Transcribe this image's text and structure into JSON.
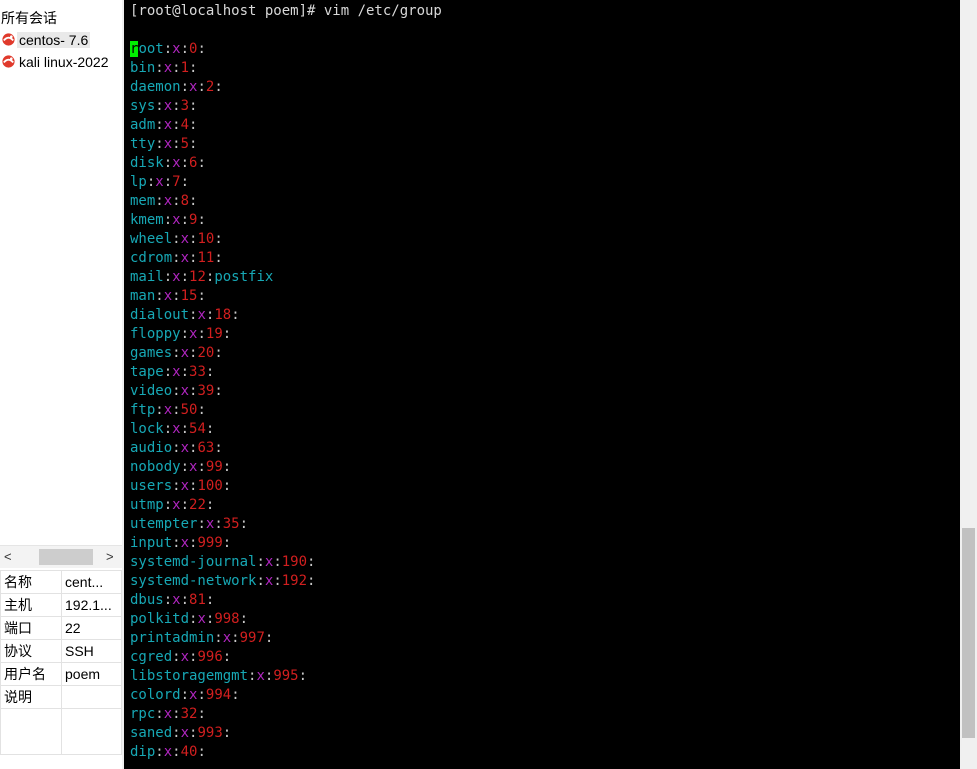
{
  "sidebar": {
    "title": "所有会话",
    "sessions": [
      {
        "label": "centos- 7.6",
        "icon": "session-logo-icon",
        "selected": true
      },
      {
        "label": "kali linux-2022",
        "icon": "session-logo-icon",
        "selected": false
      }
    ],
    "scroll": {
      "left": "<",
      "right": ">"
    },
    "properties": [
      {
        "key": "名称",
        "value": "cent..."
      },
      {
        "key": "主机",
        "value": "192.1..."
      },
      {
        "key": "端口",
        "value": "22"
      },
      {
        "key": "协议",
        "value": "SSH"
      },
      {
        "key": "用户名",
        "value": "poem"
      },
      {
        "key": "说明",
        "value": ""
      }
    ]
  },
  "terminal": {
    "prompt": "[root@localhost poem]# vim /etc/group",
    "colors": {
      "background": "#000000",
      "name": "#17a8b5",
      "password": "#b026c0",
      "gid": "#d21f1f",
      "cursor": "#00ee00"
    },
    "entries": [
      {
        "name": "root",
        "pw": "x",
        "gid": "0",
        "members": ""
      },
      {
        "name": "bin",
        "pw": "x",
        "gid": "1",
        "members": ""
      },
      {
        "name": "daemon",
        "pw": "x",
        "gid": "2",
        "members": ""
      },
      {
        "name": "sys",
        "pw": "x",
        "gid": "3",
        "members": ""
      },
      {
        "name": "adm",
        "pw": "x",
        "gid": "4",
        "members": ""
      },
      {
        "name": "tty",
        "pw": "x",
        "gid": "5",
        "members": ""
      },
      {
        "name": "disk",
        "pw": "x",
        "gid": "6",
        "members": ""
      },
      {
        "name": "lp",
        "pw": "x",
        "gid": "7",
        "members": ""
      },
      {
        "name": "mem",
        "pw": "x",
        "gid": "8",
        "members": ""
      },
      {
        "name": "kmem",
        "pw": "x",
        "gid": "9",
        "members": ""
      },
      {
        "name": "wheel",
        "pw": "x",
        "gid": "10",
        "members": ""
      },
      {
        "name": "cdrom",
        "pw": "x",
        "gid": "11",
        "members": ""
      },
      {
        "name": "mail",
        "pw": "x",
        "gid": "12",
        "members": "postfix"
      },
      {
        "name": "man",
        "pw": "x",
        "gid": "15",
        "members": ""
      },
      {
        "name": "dialout",
        "pw": "x",
        "gid": "18",
        "members": ""
      },
      {
        "name": "floppy",
        "pw": "x",
        "gid": "19",
        "members": ""
      },
      {
        "name": "games",
        "pw": "x",
        "gid": "20",
        "members": ""
      },
      {
        "name": "tape",
        "pw": "x",
        "gid": "33",
        "members": ""
      },
      {
        "name": "video",
        "pw": "x",
        "gid": "39",
        "members": ""
      },
      {
        "name": "ftp",
        "pw": "x",
        "gid": "50",
        "members": ""
      },
      {
        "name": "lock",
        "pw": "x",
        "gid": "54",
        "members": ""
      },
      {
        "name": "audio",
        "pw": "x",
        "gid": "63",
        "members": ""
      },
      {
        "name": "nobody",
        "pw": "x",
        "gid": "99",
        "members": ""
      },
      {
        "name": "users",
        "pw": "x",
        "gid": "100",
        "members": ""
      },
      {
        "name": "utmp",
        "pw": "x",
        "gid": "22",
        "members": ""
      },
      {
        "name": "utempter",
        "pw": "x",
        "gid": "35",
        "members": ""
      },
      {
        "name": "input",
        "pw": "x",
        "gid": "999",
        "members": ""
      },
      {
        "name": "systemd-journal",
        "pw": "x",
        "gid": "190",
        "members": ""
      },
      {
        "name": "systemd-network",
        "pw": "x",
        "gid": "192",
        "members": ""
      },
      {
        "name": "dbus",
        "pw": "x",
        "gid": "81",
        "members": ""
      },
      {
        "name": "polkitd",
        "pw": "x",
        "gid": "998",
        "members": ""
      },
      {
        "name": "printadmin",
        "pw": "x",
        "gid": "997",
        "members": ""
      },
      {
        "name": "cgred",
        "pw": "x",
        "gid": "996",
        "members": ""
      },
      {
        "name": "libstoragemgmt",
        "pw": "x",
        "gid": "995",
        "members": ""
      },
      {
        "name": "colord",
        "pw": "x",
        "gid": "994",
        "members": ""
      },
      {
        "name": "rpc",
        "pw": "x",
        "gid": "32",
        "members": ""
      },
      {
        "name": "saned",
        "pw": "x",
        "gid": "993",
        "members": ""
      },
      {
        "name": "dip",
        "pw": "x",
        "gid": "40",
        "members": ""
      }
    ]
  }
}
